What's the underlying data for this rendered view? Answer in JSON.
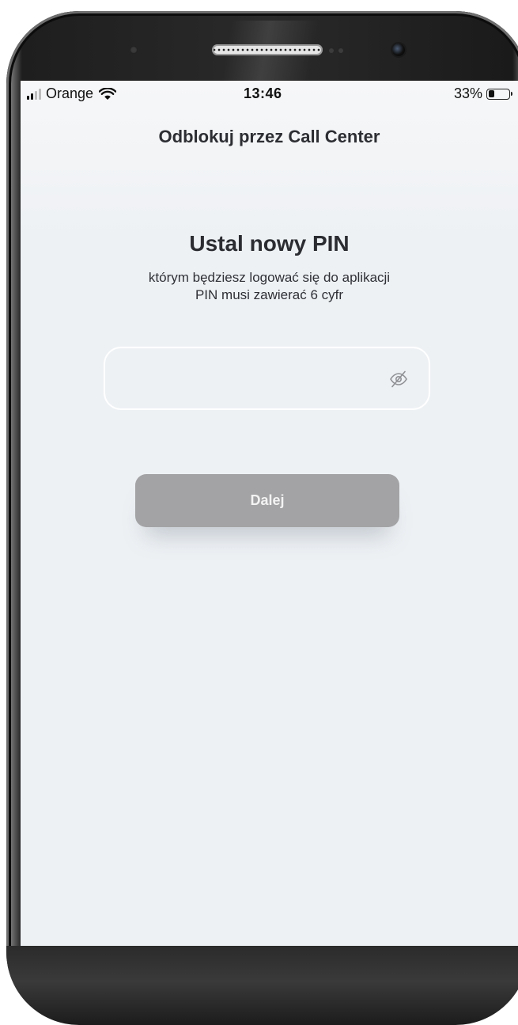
{
  "status_bar": {
    "carrier": "Orange",
    "time": "13:46",
    "battery_percent": "33%",
    "battery_level": 0.33,
    "signal_bars_active": 2,
    "signal_bars_total": 4
  },
  "header": {
    "title": "Odblokuj przez Call Center"
  },
  "main": {
    "title": "Ustal nowy PIN",
    "subtitle_line1": "którym będziesz logować się do aplikacji",
    "subtitle_line2": "PIN musi zawierać 6 cyfr",
    "pin_field": {
      "value": "",
      "placeholder": ""
    },
    "next_button_label": "Dalej",
    "next_button_enabled": false
  },
  "icons": [
    "signal-icon",
    "wifi-icon",
    "battery-icon",
    "eye-off-icon"
  ]
}
